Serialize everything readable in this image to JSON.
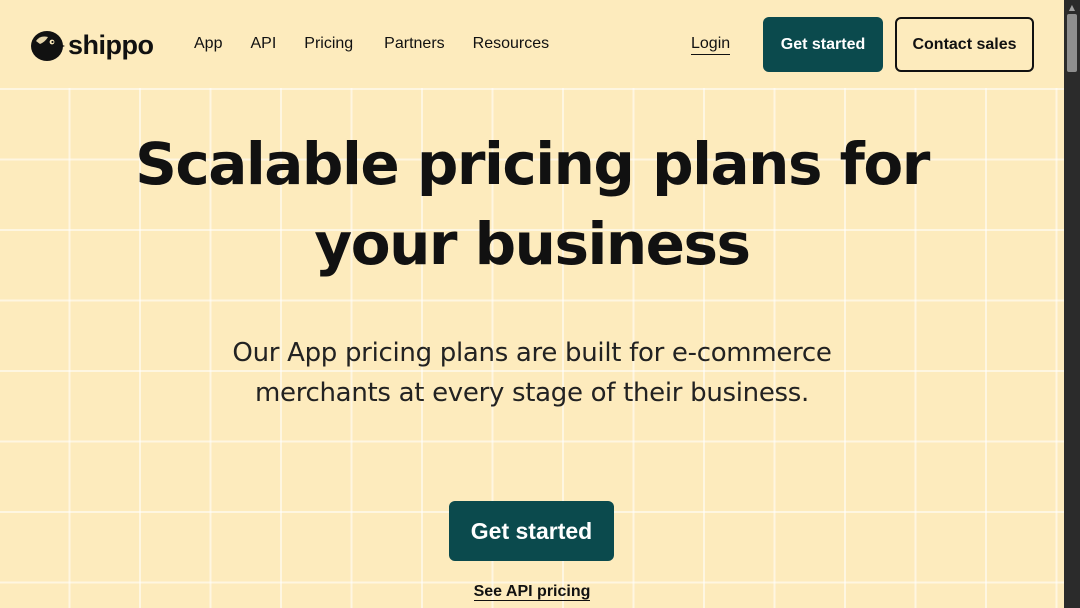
{
  "brand": {
    "name": "shippo",
    "logo_icon": "shippo-bird-logo-icon"
  },
  "nav": {
    "items": [
      "App",
      "API",
      "Pricing",
      "Partners",
      "Resources"
    ]
  },
  "header": {
    "login_label": "Login",
    "get_started_label": "Get started",
    "contact_sales_label": "Contact sales"
  },
  "hero": {
    "title_line1": "Scalable pricing plans for",
    "title_line2": "your business",
    "subtitle_line1": "Our App pricing plans are built for e-commerce",
    "subtitle_line2": "merchants at every stage of their business.",
    "cta_label": "Get started",
    "api_link_label": "See API pricing"
  },
  "colors": {
    "background": "#fdebbd",
    "primary": "#0b4a4d",
    "text": "#111111"
  }
}
